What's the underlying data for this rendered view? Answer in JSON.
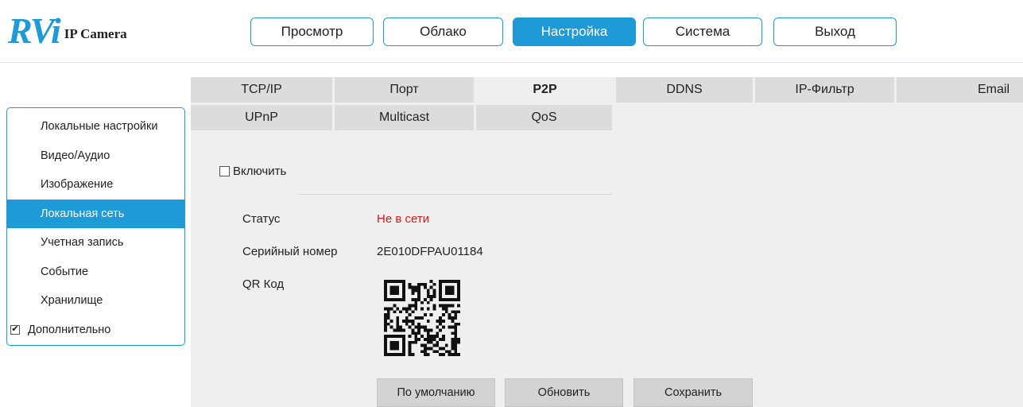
{
  "logo": {
    "mark": "RVi",
    "text": "IP Camera"
  },
  "topnav": [
    {
      "label": "Просмотр",
      "active": false
    },
    {
      "label": "Облако",
      "active": false
    },
    {
      "label": "Настройка",
      "active": true
    },
    {
      "label": "Система",
      "active": false
    },
    {
      "label": "Выход",
      "active": false
    }
  ],
  "sidebar": {
    "items": [
      {
        "label": "Локальные настройки"
      },
      {
        "label": "Видео/Аудио"
      },
      {
        "label": "Изображение"
      },
      {
        "label": "Локальная сеть",
        "active": true
      },
      {
        "label": "Учетная запись"
      },
      {
        "label": "Событие"
      },
      {
        "label": "Хранилище"
      }
    ],
    "advanced": {
      "label": "Дополнительно",
      "checked": true
    }
  },
  "tabs": {
    "row1": [
      "TCP/IP",
      "Порт",
      "P2P",
      "DDNS",
      "IP-Фильтр",
      "Email"
    ],
    "row2": [
      "UPnP",
      "Multicast",
      "QoS"
    ],
    "active": "P2P"
  },
  "p2p": {
    "enable_label": "Включить",
    "enable_checked": false,
    "status_label": "Статус",
    "status_value": "Не в сети",
    "serial_label": "Серийный номер",
    "serial_value": "2E010DFPAU01184",
    "qr_label": "QR Код"
  },
  "actions": {
    "default_label": "По умолчанию",
    "refresh_label": "Обновить",
    "save_label": "Сохранить"
  },
  "colors": {
    "accent": "#1e9ad6",
    "status_offline": "#e11818",
    "panel_bg": "#efefef",
    "tab_bg": "#dcdcdc"
  }
}
